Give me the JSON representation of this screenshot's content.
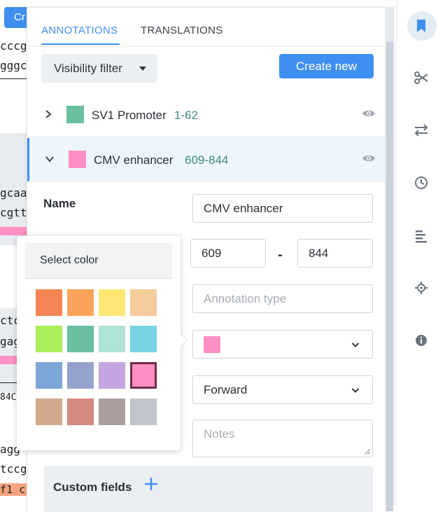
{
  "background": {
    "button_label": "Cr",
    "sequence_lines": [
      "cccg",
      "gggc",
      "gcaa",
      "cgtt",
      "ctc",
      "gag",
      "84C",
      "agg",
      "tccg",
      "f1 c"
    ]
  },
  "panel": {
    "tabs": [
      {
        "label": "ANNOTATIONS",
        "active": true
      },
      {
        "label": "TRANSLATIONS",
        "active": false
      }
    ],
    "visibility_filter_label": "Visibility filter",
    "create_new_label": "Create new",
    "annotations": [
      {
        "name": "SV1 Promoter",
        "range": "1-62",
        "color": "#6abf9e",
        "expanded": false
      },
      {
        "name": "CMV enhancer",
        "range": "609-844",
        "color": "#ff8fc4",
        "expanded": true
      }
    ],
    "form": {
      "name_label": "Name",
      "name_value": "CMV enhancer",
      "start_value": "609",
      "range_separator": "-",
      "end_value": "844",
      "type_placeholder": "Annotation type",
      "color_value": "#ff8fc4",
      "direction_value": "Forward",
      "notes_placeholder": "Notes",
      "custom_fields_label": "Custom fields"
    }
  },
  "color_popover": {
    "title": "Select color",
    "selected": "#ff8fc4",
    "colors": [
      "#f58454",
      "#f9a45a",
      "#fde674",
      "#f5cb9c",
      "#a9f05b",
      "#6abf9e",
      "#b0e3d6",
      "#78d4e3",
      "#7da6d8",
      "#95a3cc",
      "#c3a6e0",
      "#ff8fc4",
      "#d2a88c",
      "#d2897f",
      "#ab9f9e",
      "#c1c4cc"
    ]
  },
  "toolbar": {
    "tools": [
      "bookmark-icon",
      "scissors-icon",
      "swap-icon",
      "history-icon",
      "align-icon",
      "target-icon",
      "info-icon"
    ],
    "active": "bookmark-icon",
    "accent": "#3f8ff0",
    "icon_color": "#6b747e"
  }
}
